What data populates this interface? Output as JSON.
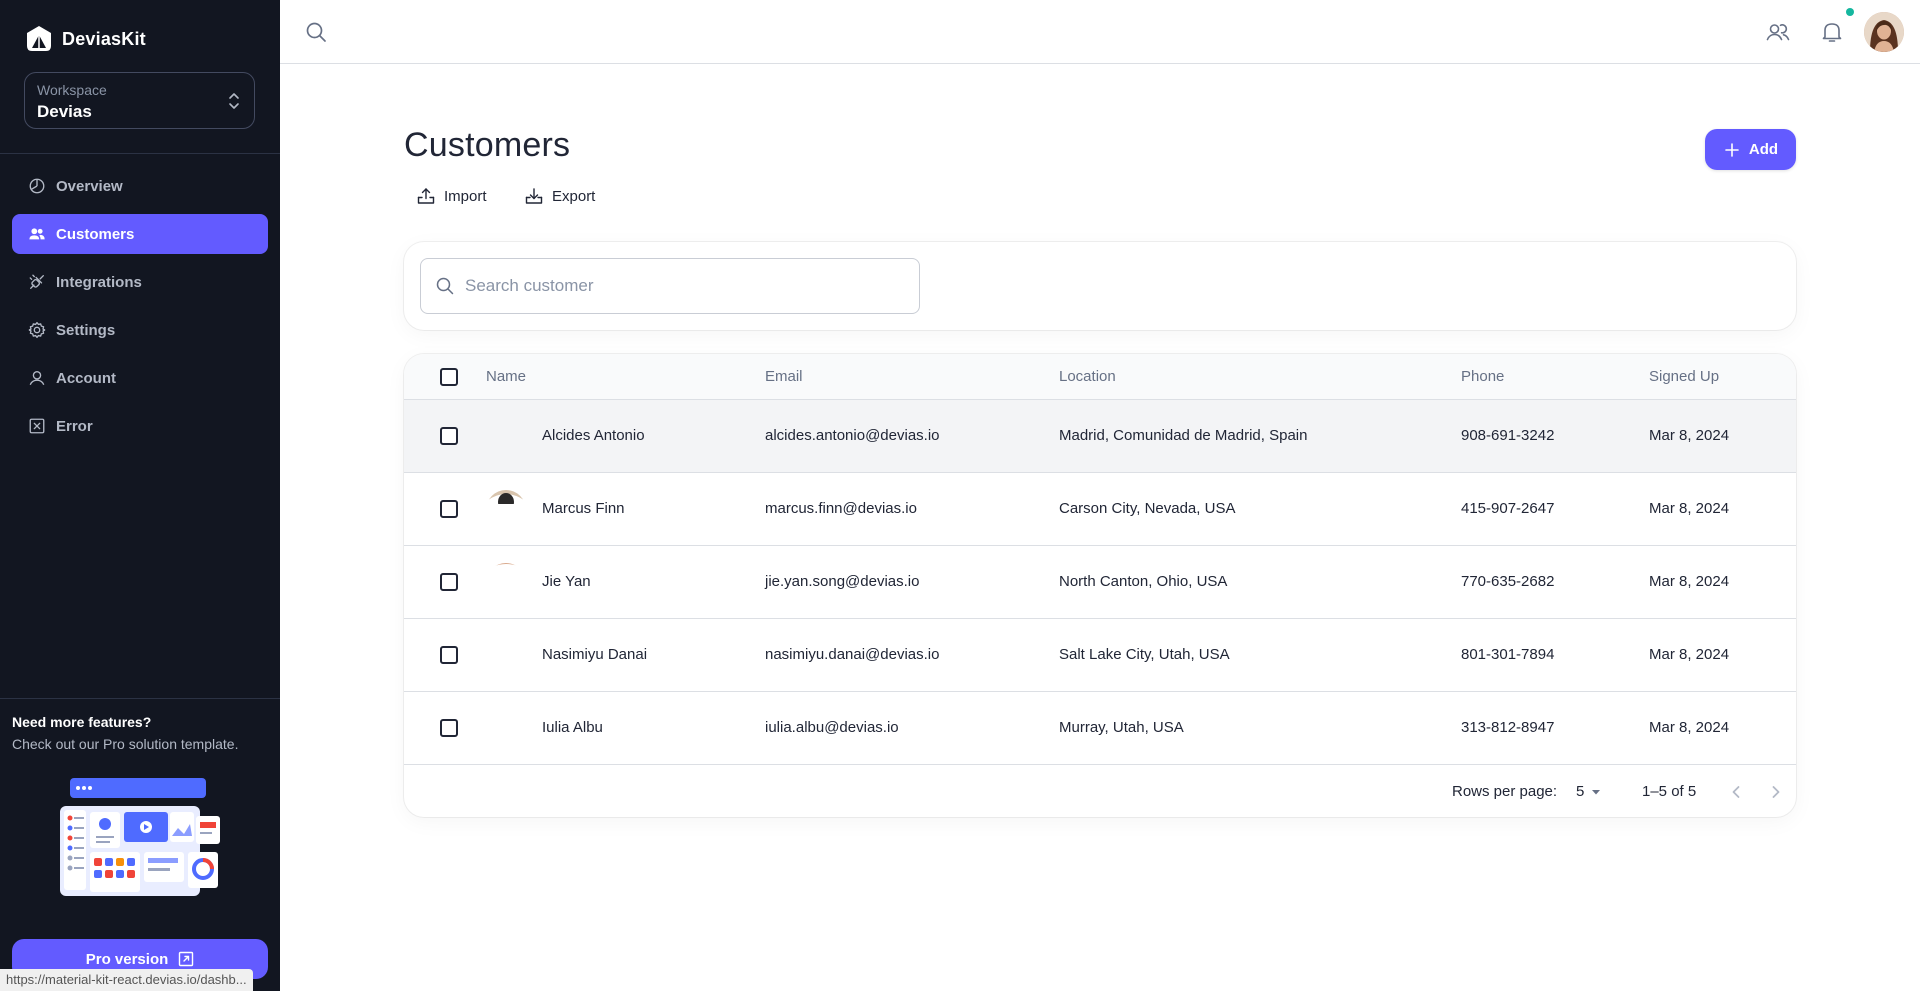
{
  "app": {
    "brand_name": "DeviasKit",
    "accent_color": "#635bff",
    "sidebar_bg": "#121621"
  },
  "workspace": {
    "label": "Workspace",
    "value": "Devias"
  },
  "sidebar": {
    "items": [
      {
        "label": "Overview",
        "icon": "chart-pie-icon",
        "active": false
      },
      {
        "label": "Customers",
        "icon": "users-icon",
        "active": true
      },
      {
        "label": "Integrations",
        "icon": "plugs-connected-icon",
        "active": false
      },
      {
        "label": "Settings",
        "icon": "gear-icon",
        "active": false
      },
      {
        "label": "Account",
        "icon": "user-icon",
        "active": false
      },
      {
        "label": "Error",
        "icon": "x-square-icon",
        "active": false
      }
    ],
    "promo": {
      "title": "Need more features?",
      "subtitle": "Check out our Pro solution template."
    },
    "pro_button_label": "Pro version"
  },
  "status_bar": {
    "url": "https://material-kit-react.devias.io/dashb..."
  },
  "topbar": {
    "icons": [
      "search-icon",
      "contacts-icon",
      "bell-icon",
      "user-avatar"
    ]
  },
  "page": {
    "title": "Customers",
    "import_label": "Import",
    "export_label": "Export",
    "add_label": "Add"
  },
  "search": {
    "placeholder": "Search customer",
    "value": ""
  },
  "table": {
    "columns": [
      "Name",
      "Email",
      "Location",
      "Phone",
      "Signed Up"
    ],
    "rows": [
      {
        "name": "Alcides Antonio",
        "email": "alcides.antonio@devias.io",
        "location": "Madrid, Comunidad de Madrid, Spain",
        "phone": "908-691-3242",
        "signed_up": "Mar 8, 2024"
      },
      {
        "name": "Marcus Finn",
        "email": "marcus.finn@devias.io",
        "location": "Carson City, Nevada, USA",
        "phone": "415-907-2647",
        "signed_up": "Mar 8, 2024"
      },
      {
        "name": "Jie Yan",
        "email": "jie.yan.song@devias.io",
        "location": "North Canton, Ohio, USA",
        "phone": "770-635-2682",
        "signed_up": "Mar 8, 2024"
      },
      {
        "name": "Nasimiyu Danai",
        "email": "nasimiyu.danai@devias.io",
        "location": "Salt Lake City, Utah, USA",
        "phone": "801-301-7894",
        "signed_up": "Mar 8, 2024"
      },
      {
        "name": "Iulia Albu",
        "email": "iulia.albu@devias.io",
        "location": "Murray, Utah, USA",
        "phone": "313-812-8947",
        "signed_up": "Mar 8, 2024"
      }
    ]
  },
  "pagination": {
    "rows_per_page_label": "Rows per page:",
    "rows_per_page_value": "5",
    "range_label": "1–5 of 5"
  }
}
